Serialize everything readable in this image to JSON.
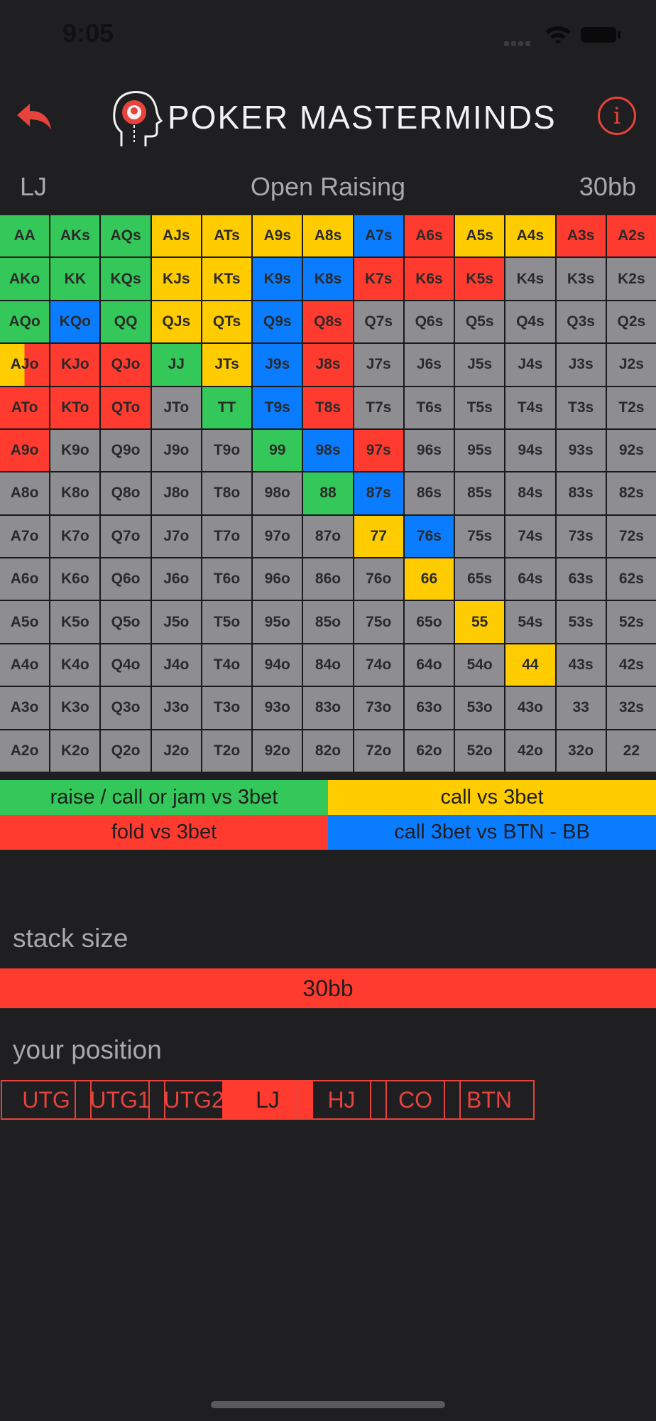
{
  "status": {
    "time": "9:05"
  },
  "header": {
    "brand": "POKER MASTERMINDS",
    "info_symbol": "i"
  },
  "subheader": {
    "position": "LJ",
    "title": "Open Raising",
    "stack": "30bb"
  },
  "grid": {
    "rows": [
      [
        [
          "AA",
          "g"
        ],
        [
          "AKs",
          "g"
        ],
        [
          "AQs",
          "g"
        ],
        [
          "AJs",
          "y"
        ],
        [
          "ATs",
          "y"
        ],
        [
          "A9s",
          "y"
        ],
        [
          "A8s",
          "y"
        ],
        [
          "A7s",
          "b"
        ],
        [
          "A6s",
          "r"
        ],
        [
          "A5s",
          "y"
        ],
        [
          "A4s",
          "y"
        ],
        [
          "A3s",
          "r"
        ],
        [
          "A2s",
          "r"
        ]
      ],
      [
        [
          "AKo",
          "g"
        ],
        [
          "KK",
          "g"
        ],
        [
          "KQs",
          "g"
        ],
        [
          "KJs",
          "y"
        ],
        [
          "KTs",
          "y"
        ],
        [
          "K9s",
          "b"
        ],
        [
          "K8s",
          "b"
        ],
        [
          "K7s",
          "r"
        ],
        [
          "K6s",
          "r"
        ],
        [
          "K5s",
          "r"
        ],
        [
          "K4s",
          ""
        ],
        [
          "K3s",
          ""
        ],
        [
          "K2s",
          ""
        ]
      ],
      [
        [
          "AQo",
          "g"
        ],
        [
          "KQo",
          "b"
        ],
        [
          "QQ",
          "g"
        ],
        [
          "QJs",
          "y"
        ],
        [
          "QTs",
          "y"
        ],
        [
          "Q9s",
          "b"
        ],
        [
          "Q8s",
          "r"
        ],
        [
          "Q7s",
          ""
        ],
        [
          "Q6s",
          ""
        ],
        [
          "Q5s",
          ""
        ],
        [
          "Q4s",
          ""
        ],
        [
          "Q3s",
          ""
        ],
        [
          "Q2s",
          ""
        ]
      ],
      [
        [
          "AJo",
          "ry"
        ],
        [
          "KJo",
          "r"
        ],
        [
          "QJo",
          "r"
        ],
        [
          "JJ",
          "g"
        ],
        [
          "JTs",
          "y"
        ],
        [
          "J9s",
          "b"
        ],
        [
          "J8s",
          "r"
        ],
        [
          "J7s",
          ""
        ],
        [
          "J6s",
          ""
        ],
        [
          "J5s",
          ""
        ],
        [
          "J4s",
          ""
        ],
        [
          "J3s",
          ""
        ],
        [
          "J2s",
          ""
        ]
      ],
      [
        [
          "ATo",
          "r"
        ],
        [
          "KTo",
          "r"
        ],
        [
          "QTo",
          "r"
        ],
        [
          "JTo",
          ""
        ],
        [
          "TT",
          "g"
        ],
        [
          "T9s",
          "b"
        ],
        [
          "T8s",
          "r"
        ],
        [
          "T7s",
          ""
        ],
        [
          "T6s",
          ""
        ],
        [
          "T5s",
          ""
        ],
        [
          "T4s",
          ""
        ],
        [
          "T3s",
          ""
        ],
        [
          "T2s",
          ""
        ]
      ],
      [
        [
          "A9o",
          "r"
        ],
        [
          "K9o",
          ""
        ],
        [
          "Q9o",
          ""
        ],
        [
          "J9o",
          ""
        ],
        [
          "T9o",
          ""
        ],
        [
          "99",
          "g"
        ],
        [
          "98s",
          "b"
        ],
        [
          "97s",
          "r"
        ],
        [
          "96s",
          ""
        ],
        [
          "95s",
          ""
        ],
        [
          "94s",
          ""
        ],
        [
          "93s",
          ""
        ],
        [
          "92s",
          ""
        ]
      ],
      [
        [
          "A8o",
          ""
        ],
        [
          "K8o",
          ""
        ],
        [
          "Q8o",
          ""
        ],
        [
          "J8o",
          ""
        ],
        [
          "T8o",
          ""
        ],
        [
          "98o",
          ""
        ],
        [
          "88",
          "g"
        ],
        [
          "87s",
          "b"
        ],
        [
          "86s",
          ""
        ],
        [
          "85s",
          ""
        ],
        [
          "84s",
          ""
        ],
        [
          "83s",
          ""
        ],
        [
          "82s",
          ""
        ]
      ],
      [
        [
          "A7o",
          ""
        ],
        [
          "K7o",
          ""
        ],
        [
          "Q7o",
          ""
        ],
        [
          "J7o",
          ""
        ],
        [
          "T7o",
          ""
        ],
        [
          "97o",
          ""
        ],
        [
          "87o",
          ""
        ],
        [
          "77",
          "y"
        ],
        [
          "76s",
          "b"
        ],
        [
          "75s",
          ""
        ],
        [
          "74s",
          ""
        ],
        [
          "73s",
          ""
        ],
        [
          "72s",
          ""
        ]
      ],
      [
        [
          "A6o",
          ""
        ],
        [
          "K6o",
          ""
        ],
        [
          "Q6o",
          ""
        ],
        [
          "J6o",
          ""
        ],
        [
          "T6o",
          ""
        ],
        [
          "96o",
          ""
        ],
        [
          "86o",
          ""
        ],
        [
          "76o",
          ""
        ],
        [
          "66",
          "y"
        ],
        [
          "65s",
          ""
        ],
        [
          "64s",
          ""
        ],
        [
          "63s",
          ""
        ],
        [
          "62s",
          ""
        ]
      ],
      [
        [
          "A5o",
          ""
        ],
        [
          "K5o",
          ""
        ],
        [
          "Q5o",
          ""
        ],
        [
          "J5o",
          ""
        ],
        [
          "T5o",
          ""
        ],
        [
          "95o",
          ""
        ],
        [
          "85o",
          ""
        ],
        [
          "75o",
          ""
        ],
        [
          "65o",
          ""
        ],
        [
          "55",
          "y"
        ],
        [
          "54s",
          ""
        ],
        [
          "53s",
          ""
        ],
        [
          "52s",
          ""
        ]
      ],
      [
        [
          "A4o",
          ""
        ],
        [
          "K4o",
          ""
        ],
        [
          "Q4o",
          ""
        ],
        [
          "J4o",
          ""
        ],
        [
          "T4o",
          ""
        ],
        [
          "94o",
          ""
        ],
        [
          "84o",
          ""
        ],
        [
          "74o",
          ""
        ],
        [
          "64o",
          ""
        ],
        [
          "54o",
          ""
        ],
        [
          "44",
          "y"
        ],
        [
          "43s",
          ""
        ],
        [
          "42s",
          ""
        ]
      ],
      [
        [
          "A3o",
          ""
        ],
        [
          "K3o",
          ""
        ],
        [
          "Q3o",
          ""
        ],
        [
          "J3o",
          ""
        ],
        [
          "T3o",
          ""
        ],
        [
          "93o",
          ""
        ],
        [
          "83o",
          ""
        ],
        [
          "73o",
          ""
        ],
        [
          "63o",
          ""
        ],
        [
          "53o",
          ""
        ],
        [
          "43o",
          ""
        ],
        [
          "33",
          ""
        ],
        [
          "32s",
          ""
        ]
      ],
      [
        [
          "A2o",
          ""
        ],
        [
          "K2o",
          ""
        ],
        [
          "Q2o",
          ""
        ],
        [
          "J2o",
          ""
        ],
        [
          "T2o",
          ""
        ],
        [
          "92o",
          ""
        ],
        [
          "82o",
          ""
        ],
        [
          "72o",
          ""
        ],
        [
          "62o",
          ""
        ],
        [
          "52o",
          ""
        ],
        [
          "42o",
          ""
        ],
        [
          "32o",
          ""
        ],
        [
          "22",
          ""
        ]
      ]
    ]
  },
  "legend": [
    {
      "label": "raise / call or jam vs 3bet",
      "color": "g"
    },
    {
      "label": "call vs 3bet",
      "color": "y"
    },
    {
      "label": "fold vs 3bet",
      "color": "r"
    },
    {
      "label": "call 3bet vs BTN - BB",
      "color": "b"
    }
  ],
  "stack_section": {
    "label": "stack size",
    "selected": "30bb"
  },
  "position_section": {
    "label": "your position",
    "options": [
      "UTG",
      "UTG1",
      "UTG2",
      "LJ",
      "HJ",
      "CO",
      "BTN"
    ],
    "selected": "LJ"
  },
  "colors": {
    "green": "#34c759",
    "yellow": "#ffcc00",
    "blue": "#0a7cff",
    "red": "#ff3b30",
    "gray": "#8e8e92",
    "accent": "#e8423c"
  }
}
